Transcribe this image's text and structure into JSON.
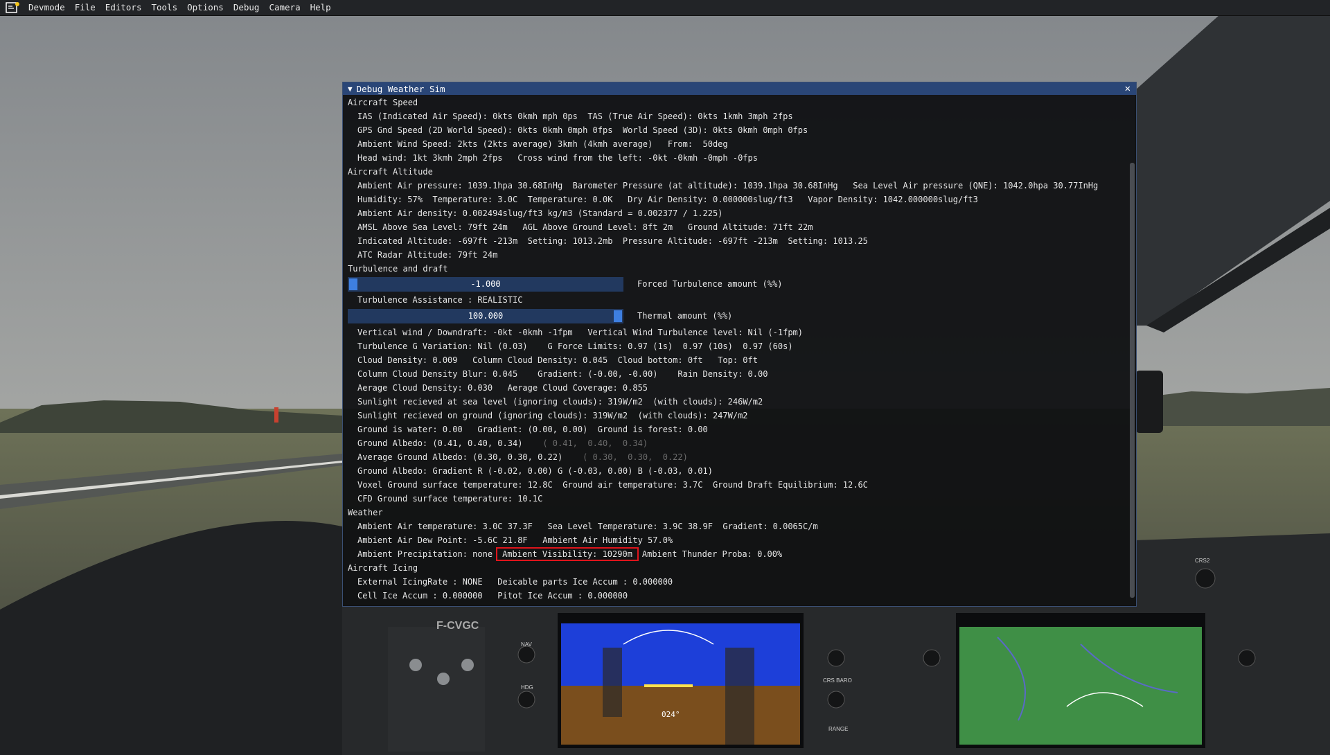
{
  "menu": {
    "items": [
      "Devmode",
      "File",
      "Editors",
      "Tools",
      "Options",
      "Debug",
      "Camera",
      "Help"
    ]
  },
  "window": {
    "title": "Debug Weather Sim",
    "collapse_icon": "triangle-down-icon",
    "close_icon": "close-icon"
  },
  "sections": {
    "aircraft_speed": "Aircraft Speed",
    "aircraft_altitude": "Aircraft Altitude",
    "turbulence": "Turbulence and draft",
    "weather": "Weather",
    "icing": "Aircraft Icing"
  },
  "lines": {
    "ias": "IAS (Indicated Air Speed): 0kts 0kmh mph 0ps  TAS (True Air Speed): 0kts 1kmh 3mph 2fps",
    "gps": "GPS Gnd Speed (2D World Speed): 0kts 0kmh 0mph 0fps  World Speed (3D): 0kts 0kmh 0mph 0fps",
    "ambient_wind": "Ambient Wind Speed: 2kts (2kts average) 3kmh (4kmh average)   From:  50deg",
    "head_wind": "Head wind: 1kt 3kmh 2mph 2fps   Cross wind from the left: -0kt -0kmh -0mph -0fps",
    "ambient_pressure": "Ambient Air pressure: 1039.1hpa 30.68InHg  Barometer Pressure (at altitude): 1039.1hpa 30.68InHg   Sea Level Air pressure (QNE): 1042.0hpa 30.77InHg",
    "humidity": "Humidity: 57%  Temperature: 3.0C  Temperature: 0.0K   Dry Air Density: 0.000000slug/ft3   Vapor Density: 1042.000000slug/ft3",
    "air_density": "Ambient Air density: 0.002494slug/ft3 kg/m3 (Standard = 0.002377 / 1.225)",
    "amsl": "AMSL Above Sea Level: 79ft 24m   AGL Above Ground Level: 8ft 2m   Ground Altitude: 71ft 22m",
    "indicated_alt": "Indicated Altitude: -697ft -213m  Setting: 1013.2mb  Pressure Altitude: -697ft -213m  Setting: 1013.25",
    "atc_radar": "ATC Radar Altitude: 79ft 24m",
    "turb_assist": "Turbulence Assistance : REALISTIC",
    "vertical_wind": "Vertical wind / Downdraft: -0kt -0kmh -1fpm   Vertical Wind Turbulence level: Nil (-1fpm)",
    "turb_g": "Turbulence G Variation: Nil (0.03)    G Force Limits: 0.97 (1s)  0.97 (10s)  0.97 (60s)",
    "cloud_density": "Cloud Density: 0.009   Column Cloud Density: 0.045  Cloud bottom: 0ft   Top: 0ft",
    "column_blur": "Column Cloud Density Blur: 0.045    Gradient: (-0.00, -0.00)    Rain Density: 0.00",
    "avg_cloud": "Aerage Cloud Density: 0.030   Aerage Cloud Coverage: 0.855",
    "sunlight_sea": "Sunlight recieved at sea level (ignoring clouds): 319W/m2  (with clouds): 246W/m2",
    "sunlight_ground": "Sunlight recieved on ground (ignoring clouds): 319W/m2  (with clouds): 247W/m2",
    "ground_water": "Ground is water: 0.00   Gradient: (0.00, 0.00)  Ground is forest: 0.00",
    "ground_albedo": "Ground Albedo: (0.41, 0.40, 0.34)",
    "ground_albedo_dim": "( 0.41,  0.40,  0.34)",
    "avg_albedo": "Average Ground Albedo: (0.30, 0.30, 0.22)",
    "avg_albedo_dim": "( 0.30,  0.30,  0.22)",
    "albedo_gradient": "Ground Albedo: Gradient R (-0.02, 0.00) G (-0.03, 0.00) B (-0.03, 0.01)",
    "voxel": "Voxel Ground surface temperature: 12.8C  Ground air temperature: 3.7C  Ground Draft Equilibrium: 12.6C",
    "cfd": "CFD Ground surface temperature: 10.1C",
    "ambient_temp": "Ambient Air temperature: 3.0C 37.3F   Sea Level Temperature: 3.9C 38.9F  Gradient: 0.0065C/m",
    "dew_point": "Ambient Air Dew Point: -5.6C 21.8F   Ambient Air Humidity 57.0%",
    "precipitation": "Ambient Precipitation: none",
    "visibility": "Ambient Visibility: 10290m",
    "thunder": "Ambient Thunder Proba: 0.00%",
    "icing_rate": "External IcingRate : NONE   Deicable parts Ice Accum : 0.000000",
    "cell_ice": "Cell Ice Accum : 0.000000   Pitot Ice Accum : 0.000000"
  },
  "sliders": {
    "forced_turbulence": {
      "value_text": "-1.000",
      "fraction": 0.0,
      "label": "Forced Turbulence amount (%%)"
    },
    "thermal": {
      "value_text": "100.000",
      "fraction": 1.0,
      "label": "Thermal amount (%%)"
    }
  },
  "cockpit": {
    "registration": "F-CVGC",
    "nav_label": "NAV",
    "hdg_label": "HDG",
    "range_label": "RANGE",
    "crs_baro_label": "CRS BARO",
    "crs2_label": "CRS2",
    "pfd_heading": "024°",
    "colors": {
      "pfd_sky": "#1d3fd9",
      "pfd_ground": "#7a4e1d",
      "mfd_map": "#3f8f46"
    }
  }
}
